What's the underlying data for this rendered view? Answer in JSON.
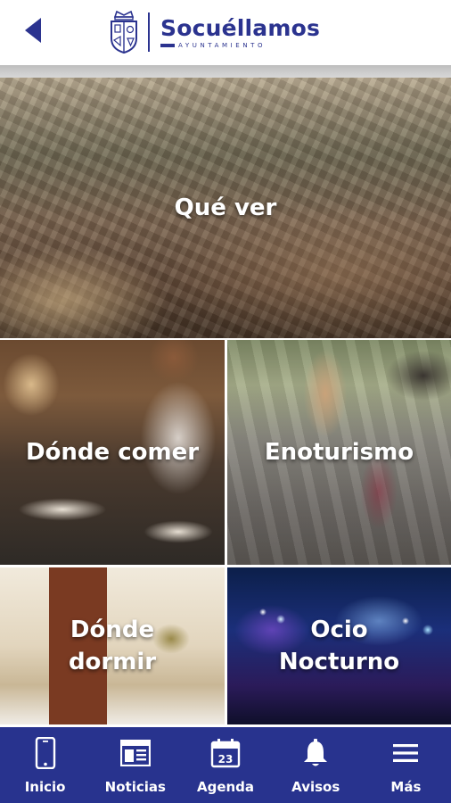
{
  "header": {
    "brand_name": "Socuéllamos",
    "brand_subtitle": "AYUNTAMIENTO",
    "brand_color": "#2b338f"
  },
  "tiles": [
    {
      "label": "Qué ver"
    },
    {
      "label": "Dónde comer"
    },
    {
      "label": "Enoturismo"
    },
    {
      "label": "Dónde\ndormir"
    },
    {
      "label": "Ocio\nNocturno"
    }
  ],
  "bottom_nav": {
    "background": "#28338e",
    "items": [
      {
        "label": "Inicio",
        "icon": "phone-icon"
      },
      {
        "label": "Noticias",
        "icon": "newspaper-icon"
      },
      {
        "label": "Agenda",
        "icon": "calendar-icon",
        "calendar_day": "23"
      },
      {
        "label": "Avisos",
        "icon": "bell-icon"
      },
      {
        "label": "Más",
        "icon": "menu-icon"
      }
    ]
  }
}
